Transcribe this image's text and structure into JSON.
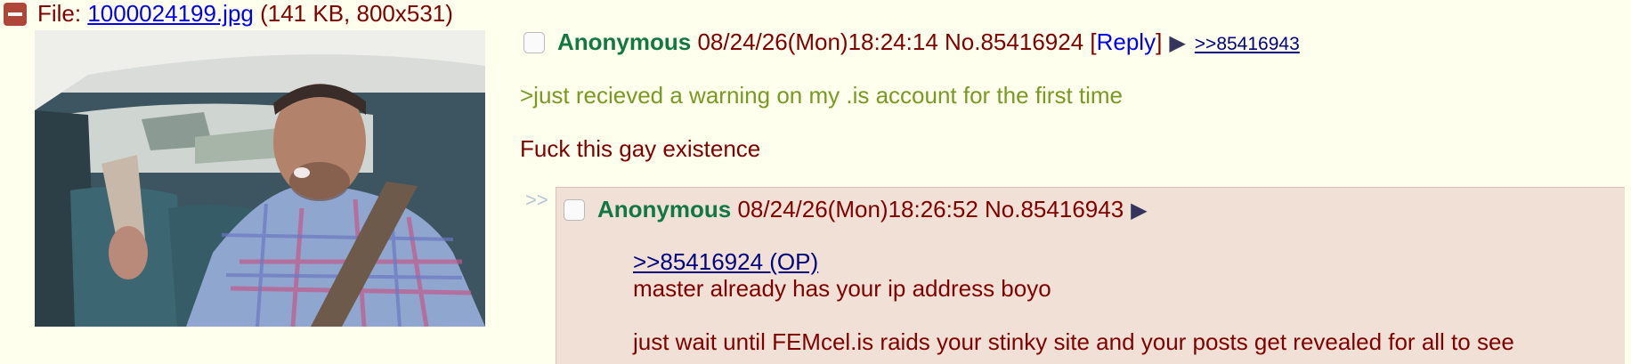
{
  "file": {
    "prefix": "File: ",
    "filename": "1000024199.jpg",
    "meta": " (141 KB, 800x531)"
  },
  "op": {
    "name": "Anonymous",
    "datetime": "08/24/26(Mon)18:24:14",
    "post_no": "No.85416924",
    "reply_open": " [",
    "reply_label": "Reply",
    "reply_close": "]",
    "menu_arrow": "▶",
    "backlink": ">>85416943",
    "greentext": ">just recieved a warning on my .is account for the first time",
    "text": "Fuck this gay existence"
  },
  "reply": {
    "side_arrows": ">>",
    "name": "Anonymous",
    "datetime": "08/24/26(Mon)18:26:52",
    "post_no": "No.85416943",
    "menu_arrow": "▶",
    "quote": ">>85416924 (OP)",
    "line1": "master already has your ip address boyo",
    "line2": "just wait until FEMcel.is raids your stinky site and your posts get revealed for all to see"
  },
  "colors": {
    "background": "#ffffee",
    "post_text": "#800000",
    "name": "#117743",
    "greentext": "#789922",
    "link": "#0000ee",
    "reply_bg": "#f0e0d6"
  }
}
